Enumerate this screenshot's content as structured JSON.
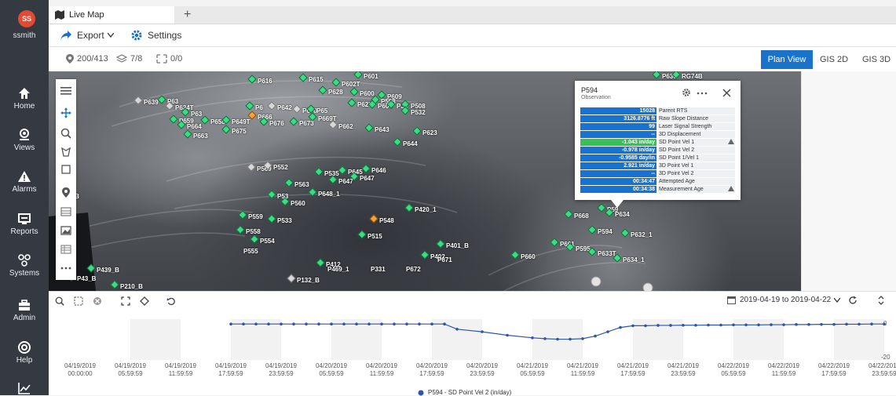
{
  "user": {
    "initials": "SS",
    "name": "ssmith"
  },
  "nav": [
    {
      "label": "Home",
      "icon": "home-icon"
    },
    {
      "label": "Views",
      "icon": "views-icon"
    },
    {
      "label": "Alarms",
      "icon": "alarm-icon"
    },
    {
      "label": "Reports",
      "icon": "reports-icon"
    },
    {
      "label": "Systems",
      "icon": "systems-icon"
    },
    {
      "label": "Admin",
      "icon": "admin-icon"
    },
    {
      "label": "Help",
      "icon": "help-icon"
    }
  ],
  "tab": {
    "title": "Live Map",
    "add": "+"
  },
  "toolbar": {
    "export": "Export",
    "settings": "Settings"
  },
  "stats": {
    "points": "200/413",
    "layers": "7/8",
    "targets": "0/0"
  },
  "views": {
    "plan": "Plan View",
    "gis2d": "GIS 2D",
    "gis3d": "GIS 3D"
  },
  "map_points": [
    {
      "label": "P616",
      "m": "green"
    },
    {
      "label": "P615",
      "m": "green"
    },
    {
      "label": "P601",
      "m": "green"
    },
    {
      "label": "P602T",
      "m": "green"
    },
    {
      "label": "P628",
      "m": "green"
    },
    {
      "label": "P600",
      "m": "green"
    },
    {
      "label": "P609",
      "m": "green"
    },
    {
      "label": "P598",
      "m": "green"
    },
    {
      "label": "P639",
      "m": "grey"
    },
    {
      "label": "P63",
      "m": "green"
    },
    {
      "label": "P627",
      "m": "green"
    },
    {
      "label": "P604",
      "m": "green"
    },
    {
      "label": "P38",
      "m": "green"
    },
    {
      "label": "P508",
      "m": "green"
    },
    {
      "label": "P532",
      "m": "green"
    },
    {
      "label": "P634T",
      "m": "grey"
    },
    {
      "label": "P6",
      "m": "green"
    },
    {
      "label": "P642",
      "m": "grey"
    },
    {
      "label": "P670",
      "m": "grey"
    },
    {
      "label": "P65",
      "m": "green"
    },
    {
      "label": "P63",
      "m": "green"
    },
    {
      "label": "P659",
      "m": "green"
    },
    {
      "label": "P658",
      "m": "green"
    },
    {
      "label": "P649T",
      "m": "green"
    },
    {
      "label": "P666",
      "m": "orange"
    },
    {
      "label": "P676",
      "m": "green"
    },
    {
      "label": "P673",
      "m": "green"
    },
    {
      "label": "P669T",
      "m": "green"
    },
    {
      "label": "P662",
      "m": "grey"
    },
    {
      "label": "P664",
      "m": "green"
    },
    {
      "label": "P675",
      "m": "green"
    },
    {
      "label": "P663",
      "m": "green"
    },
    {
      "label": "P643",
      "m": "green"
    },
    {
      "label": "P623",
      "m": "green"
    },
    {
      "label": "P644",
      "m": "green"
    },
    {
      "label": "P569",
      "m": "grey"
    },
    {
      "label": "P552",
      "m": "grey"
    },
    {
      "label": "P535",
      "m": "green"
    },
    {
      "label": "P645",
      "m": "green"
    },
    {
      "label": "P646",
      "m": "green"
    },
    {
      "label": "P647",
      "m": "green"
    },
    {
      "label": "P647",
      "m": "green"
    },
    {
      "label": "P563",
      "m": "green"
    },
    {
      "label": "P648_1",
      "m": "green"
    },
    {
      "label": "P53",
      "m": "green"
    },
    {
      "label": "P560",
      "m": "green"
    },
    {
      "label": "P457_B",
      "m": "blank"
    },
    {
      "label": "P420_1",
      "m": "green"
    },
    {
      "label": "P559",
      "m": "green"
    },
    {
      "label": "P533",
      "m": "green"
    },
    {
      "label": "P548",
      "m": "orange"
    },
    {
      "label": "P558",
      "m": "green"
    },
    {
      "label": "P554",
      "m": "green"
    },
    {
      "label": "P515",
      "m": "green"
    },
    {
      "label": "P555",
      "m": "blank"
    },
    {
      "label": "P401_B",
      "m": "green"
    },
    {
      "label": "P402",
      "m": "green"
    },
    {
      "label": "P671",
      "m": "blank"
    },
    {
      "label": "P672",
      "m": "blank"
    },
    {
      "label": "P412",
      "m": "green"
    },
    {
      "label": "P469_1",
      "m": "blank"
    },
    {
      "label": "P331",
      "m": "blank"
    },
    {
      "label": "P132_B",
      "m": "grey"
    },
    {
      "label": "P439_B",
      "m": "green"
    },
    {
      "label": "P43_B",
      "m": "green"
    },
    {
      "label": "P210_B",
      "m": "green"
    },
    {
      "label": "P660",
      "m": "green"
    },
    {
      "label": "P668",
      "m": "green"
    },
    {
      "label": "P59",
      "m": "green"
    },
    {
      "label": "P634",
      "m": "green"
    },
    {
      "label": "P594",
      "m": "green"
    },
    {
      "label": "P632_1",
      "m": "green"
    },
    {
      "label": "P661",
      "m": "green"
    },
    {
      "label": "P595",
      "m": "green"
    },
    {
      "label": "P633T",
      "m": "green"
    },
    {
      "label": "P634_1",
      "m": "green"
    },
    {
      "label": "P636",
      "m": "green"
    },
    {
      "label": "RG74B",
      "m": "green"
    }
  ],
  "popup": {
    "title": "P594",
    "subtitle": "Observation",
    "rows": [
      {
        "value": "15028",
        "label": "Parent RTS",
        "hl": false
      },
      {
        "value": "3126.8776 ft",
        "label": "Raw Slope Distance",
        "hl": false
      },
      {
        "value": "99",
        "label": "Laser Signal Strength",
        "hl": false
      },
      {
        "value": "--",
        "label": "3D Displacement",
        "hl": false
      },
      {
        "value": "-1.043 in/day",
        "label": "SD Point Vel 1",
        "hl": true
      },
      {
        "value": "-0.978 in/day",
        "label": "SD Point Vel 2",
        "hl": false
      },
      {
        "value": "-0.9585 day/in",
        "label": "SD Point 1/Vel 1",
        "hl": false
      },
      {
        "value": "2.921 in/day",
        "label": "3D Point Vel 1",
        "hl": false
      },
      {
        "value": "--",
        "label": "3D Point Vel 2",
        "hl": false
      },
      {
        "value": "00:34:47",
        "label": "Attempted Age",
        "hl": false
      },
      {
        "value": "00:34:38",
        "label": "Measurement Age",
        "hl": false
      }
    ]
  },
  "graph": {
    "date_range": "2019-04-19 to 2019-04-22"
  },
  "chart_data": {
    "type": "line",
    "x": [
      "04/19/2019 00:00:00",
      "04/19/2019 05:59:59",
      "04/19/2019 11:59:59",
      "04/19/2019 17:59:59",
      "04/19/2019 23:59:59",
      "04/20/2019 05:59:59",
      "04/20/2019 11:59:59",
      "04/20/2019 17:59:59",
      "04/20/2019 23:59:59",
      "04/21/2019 05:59:59",
      "04/21/2019 11:59:59",
      "04/21/2019 17:59:59",
      "04/21/2019 23:59:59",
      "04/22/2019 05:59:59",
      "04/22/2019 11:59:59",
      "04/22/2019 17:59:59",
      "04/22/2019 23:59:59"
    ],
    "yticks": [
      "0",
      "-20"
    ],
    "ylim": [
      -20,
      0
    ],
    "series": [
      {
        "name": "P594 - SD Point Vel 2 (in/day)",
        "color": "#2f56a5",
        "points": [
          [
            3.0,
            -1
          ],
          [
            3.25,
            -1
          ],
          [
            3.5,
            -1
          ],
          [
            3.75,
            -1
          ],
          [
            4.0,
            -1
          ],
          [
            4.25,
            -1
          ],
          [
            4.5,
            -1
          ],
          [
            4.75,
            -1
          ],
          [
            5.0,
            -1
          ],
          [
            5.25,
            -1
          ],
          [
            5.5,
            -1
          ],
          [
            5.75,
            -1
          ],
          [
            6.0,
            -1
          ],
          [
            6.25,
            -1
          ],
          [
            6.5,
            -1
          ],
          [
            6.75,
            -1
          ],
          [
            7.0,
            -1
          ],
          [
            7.25,
            -1
          ],
          [
            7.5,
            -4
          ],
          [
            8.0,
            -5.5
          ],
          [
            8.5,
            -7.5
          ],
          [
            9.0,
            -9
          ],
          [
            9.25,
            -9.5
          ],
          [
            9.5,
            -9.8
          ],
          [
            9.75,
            -9.8
          ],
          [
            10.0,
            -9.5
          ],
          [
            10.25,
            -8
          ],
          [
            10.5,
            -5.5
          ],
          [
            10.75,
            -3
          ],
          [
            11.0,
            -2
          ],
          [
            11.25,
            -2
          ],
          [
            11.5,
            -1.8
          ],
          [
            11.75,
            -1.8
          ],
          [
            12.0,
            -1.7
          ],
          [
            12.25,
            -1.7
          ],
          [
            12.5,
            -1.6
          ],
          [
            12.75,
            -1.6
          ],
          [
            13.0,
            -1.5
          ],
          [
            13.25,
            -1.5
          ],
          [
            13.5,
            -1.5
          ],
          [
            13.75,
            -1.4
          ],
          [
            14.0,
            -1.4
          ],
          [
            14.25,
            -1.3
          ],
          [
            14.5,
            -1.3
          ],
          [
            14.75,
            -1.2
          ],
          [
            15.0,
            -1.2
          ],
          [
            15.25,
            -1.1
          ],
          [
            15.5,
            -1.1
          ],
          [
            15.75,
            -1.0
          ],
          [
            16.0,
            -1.0
          ]
        ]
      }
    ]
  }
}
